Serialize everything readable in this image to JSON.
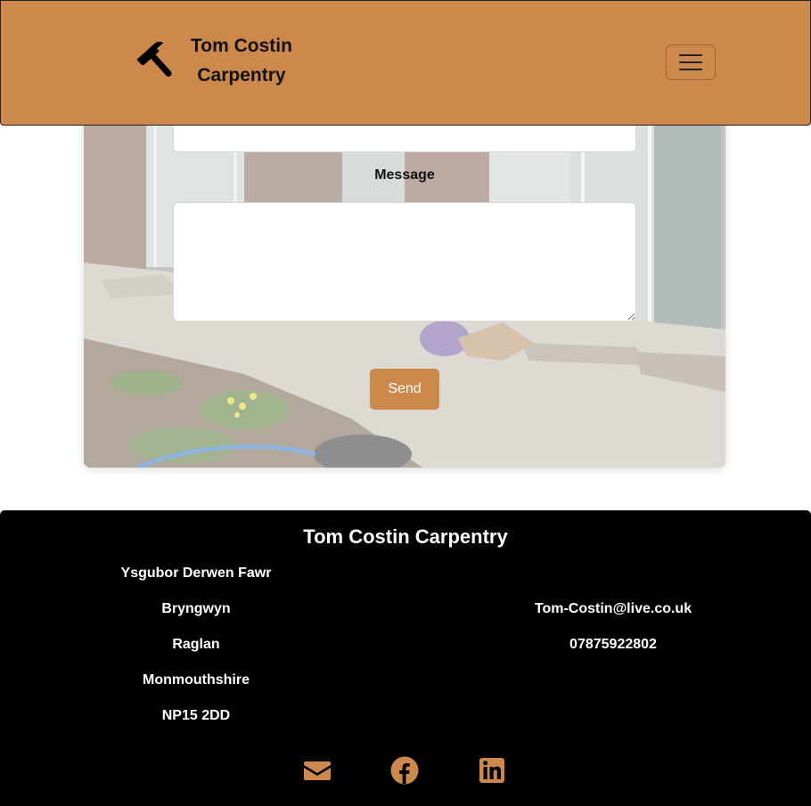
{
  "brand": {
    "name_line1": "Tom Costin",
    "name_line2": "Carpentry",
    "icon": "hammer-icon"
  },
  "navbar": {
    "toggle_icon": "menu-icon",
    "background": "#cd884b"
  },
  "contact_form": {
    "message_label": "Message",
    "message_value": "",
    "send_label": "Send"
  },
  "footer": {
    "title": "Tom Costin Carpentry",
    "address": [
      "Ysgubor Derwen Fawr",
      "Bryngwyn",
      "Raglan",
      "Monmouthshire",
      "NP15 2DD"
    ],
    "email": "Tom-Costin@live.co.uk",
    "phone": "07875922802",
    "social_icons": [
      "envelope-icon",
      "facebook-icon",
      "linkedin-icon"
    ],
    "icon_color": "#cd884b"
  }
}
